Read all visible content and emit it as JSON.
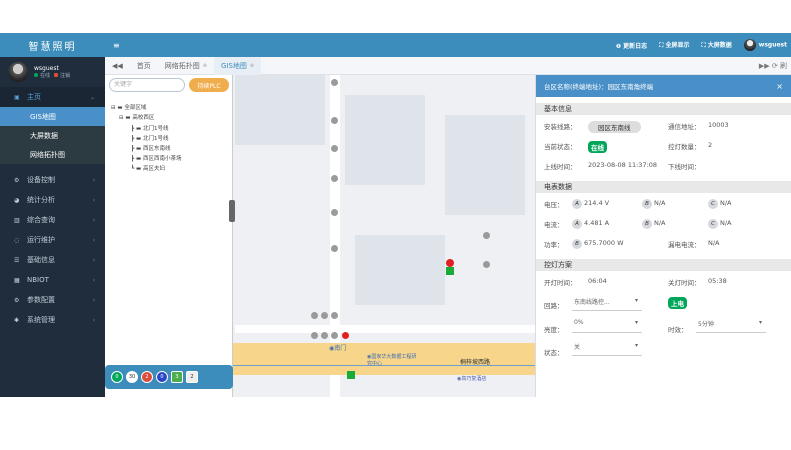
{
  "brand": "智慧照明",
  "user": {
    "name": "wsguest",
    "online": "在线",
    "logout": "注销"
  },
  "sidebar": {
    "main": "主页",
    "subs": [
      "GIS地图",
      "大屏数据",
      "网络拓扑图"
    ],
    "items": [
      "设备控制",
      "统计分析",
      "综合查询",
      "运行维护",
      "基础信息",
      "NBIOT",
      "参数配置",
      "系统管理"
    ]
  },
  "header": {
    "menu_icon": "≡",
    "changelog": "更新日志",
    "fullscreen": "全屏显示",
    "bigscreen": "大屏数据",
    "username": "wsguest"
  },
  "tabs": [
    "首页",
    "网络拓扑图",
    "GIS地图"
  ],
  "tabs_right": "▶▶ ⟳ 刷",
  "tree": {
    "search_placeholder": "关键字",
    "plc_button": "持续PLC",
    "root": "全部区域",
    "area": "高校西区",
    "leaves": [
      "北门1号线",
      "北门1号线",
      "西区东南线",
      "西区西南小茶场",
      "高区夫妇"
    ]
  },
  "legend": [
    "0",
    "30",
    "2",
    "0",
    "3",
    "2"
  ],
  "legend_colors": [
    "#00a65a",
    "#ffffff",
    "#dd4b39",
    "#2a46c8",
    "#4cae4c",
    "#eeeeee"
  ],
  "map_labels": {
    "poi1": "南门",
    "poi2": "国家华大数据工程研究中心",
    "poi3": "高巧复酒店",
    "road1": "桐梓坡西路",
    "road2": "桐梓坡西路"
  },
  "info": {
    "title": "台区名称(终端地址)：园区东南角终端",
    "basic": "基本信息",
    "install_line_label": "安装线路：",
    "install_line": "园区东南线",
    "comm_addr_label": "通信地址：",
    "comm_addr": "10003",
    "status_label": "当前状态：",
    "status": "在线",
    "control_count_label": "控灯数量：",
    "control_count": "2",
    "online_time_label": "上线时间：",
    "online_time": "2023-08-08 11:37:08",
    "offline_time_label": "下线时间：",
    "electric": "电表数据",
    "voltage_label": "电压：",
    "current_label": "电流：",
    "power_label": "功率：",
    "va": "214.4 V",
    "vb": "N/A",
    "vc": "N/A",
    "ia": "4.481 A",
    "ib": "N/A",
    "ic": "N/A",
    "pwr": "675.7000 W",
    "leak_label": "漏电电流：",
    "leak": "N/A",
    "plan": "控灯方案",
    "on_time_label": "开灯时间：",
    "on_time": "06:04",
    "off_time_label": "关灯时间：",
    "off_time": "05:38",
    "loop_label": "回路：",
    "loop_value": "东南线路控...",
    "power_on": "上电",
    "brightness_label": "亮度：",
    "brightness": "0%",
    "duration_label": "时效：",
    "duration": "5分钟",
    "state_label": "状态：",
    "state": "关"
  }
}
